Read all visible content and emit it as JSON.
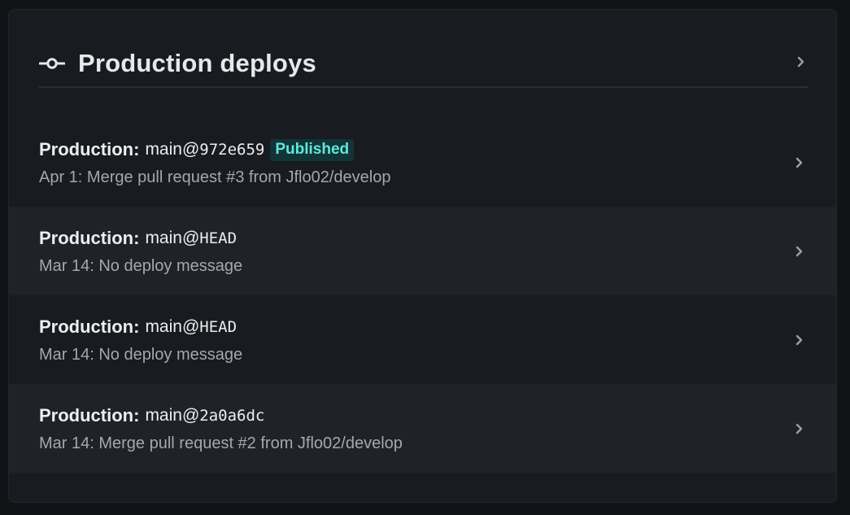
{
  "panel": {
    "title": "Production deploys",
    "title_icon": "commit-icon",
    "chevron_icon": "chevron-right-icon"
  },
  "deploys": [
    {
      "label": "Production:",
      "branch": "main@",
      "ref": "972e659",
      "badge": "Published",
      "message": "Apr 1: Merge pull request #3 from Jflo02/develop"
    },
    {
      "label": "Production:",
      "branch": "main@",
      "ref": "HEAD",
      "badge": null,
      "message": "Mar 14: No deploy message"
    },
    {
      "label": "Production:",
      "branch": "main@",
      "ref": "HEAD",
      "badge": null,
      "message": "Mar 14: No deploy message"
    },
    {
      "label": "Production:",
      "branch": "main@",
      "ref": "2a0a6dc",
      "badge": null,
      "message": "Mar 14: Merge pull request #2 from Jflo02/develop"
    }
  ],
  "colors": {
    "background": "#111416",
    "panel": "#181b1f",
    "row_alt": "#1f2328",
    "badge_bg": "#123437",
    "badge_text": "#5ee8dc"
  }
}
